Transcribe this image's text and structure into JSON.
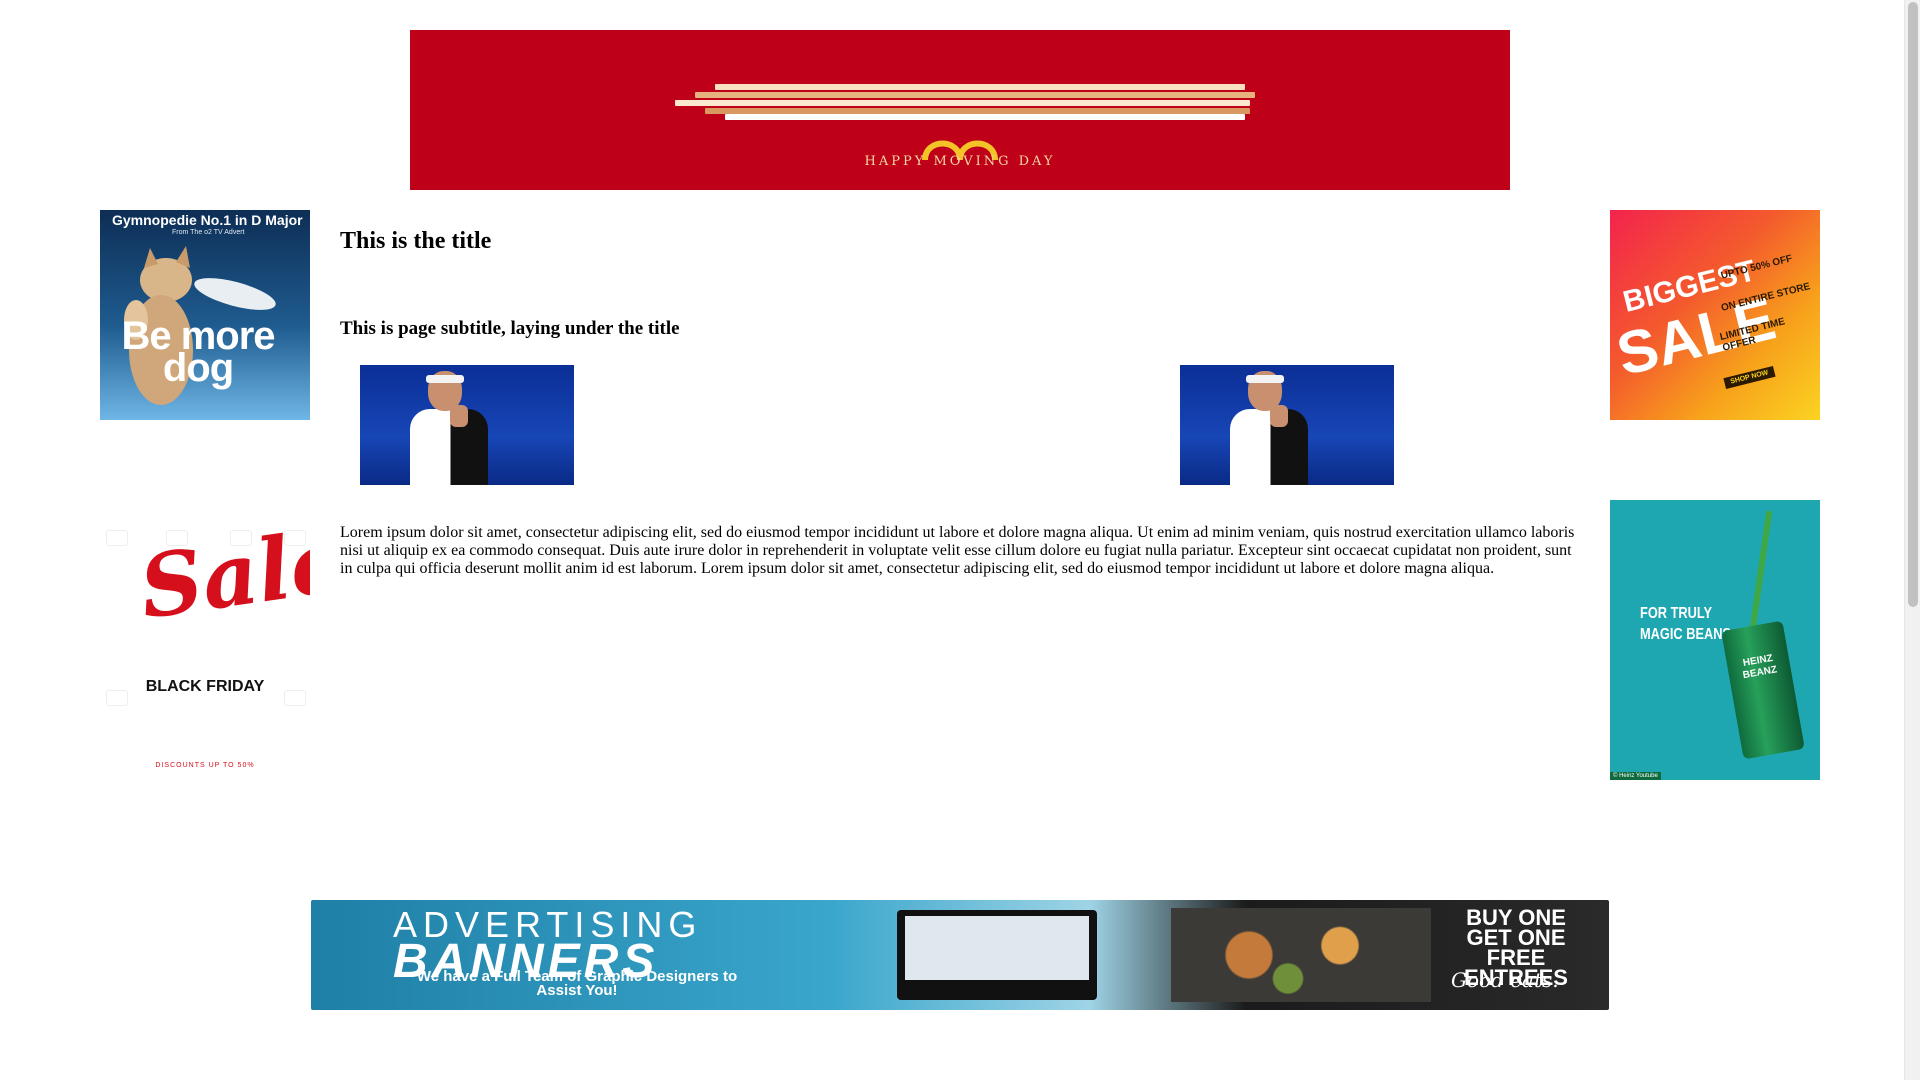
{
  "top_banner": {
    "caption": "HAPPY MOVING DAY",
    "background": "#be0019"
  },
  "left_ads": [
    {
      "title": "Gymnopedie No.1 in D Major",
      "subtitle": "From The o2 TV Advert",
      "headline": "Be more dog"
    },
    {
      "headline": "Sale",
      "tag": "BLACK FRIDAY",
      "small": "DISCOUNTS UP TO 50%"
    }
  ],
  "right_ads": [
    {
      "line1": "BIGGEST",
      "line2": "SALE",
      "offers": [
        "UPTO 50% OFF",
        "ON ENTIRE STORE",
        "LIMITED TIME OFFER"
      ],
      "cta": "SHOP NOW"
    },
    {
      "lines": [
        "FOR TRULY",
        "MAGIC BEANS"
      ],
      "can_label": "HEINZ BEANZ",
      "credit": "© Heinz Youtube"
    }
  ],
  "main": {
    "title": "This is the title",
    "subtitle": "This is page subtitle, laying under the title",
    "body": "Lorem ipsum dolor sit amet, consectetur adipiscing elit, sed do eiusmod tempor incididunt ut labore et dolore magna aliqua. Ut enim ad minim veniam, quis nostrud exercitation ullamco laboris nisi ut aliquip ex ea commodo consequat. Duis aute irure dolor in reprehenderit in voluptate velit esse cillum dolore eu fugiat nulla pariatur. Excepteur sint occaecat cupidatat non proident, sunt in culpa qui officia deserunt mollit anim id est laborum. Lorem ipsum dolor sit amet, consectetur adipiscing elit, sed do eiusmod tempor incididunt ut labore et dolore magna aliqua."
  },
  "bottom_banner": {
    "line1": "ADVERTISING",
    "line2": "BANNERS",
    "tagline": "We have a Full Team of Graphic Designers to Assist You!",
    "promo": "BUY ONE GET ONE FREE ENTREES",
    "sign": "Good eats."
  }
}
